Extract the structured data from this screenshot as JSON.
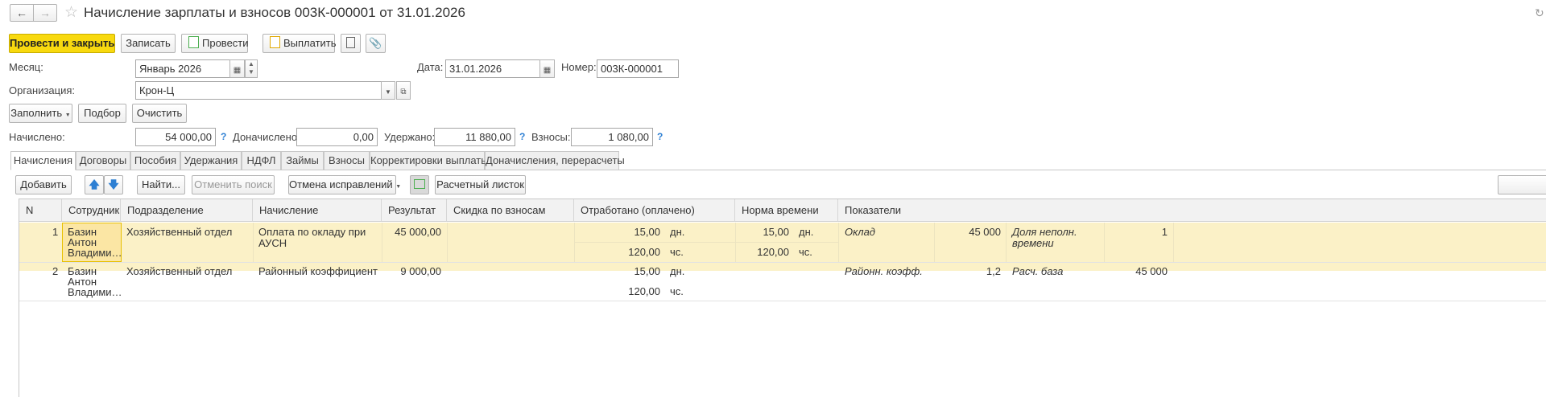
{
  "header": {
    "title": "Начисление зарплаты и взносов 003К-000001 от 31.01.2026"
  },
  "toolbar": {
    "post_close": "Провести и закрыть",
    "save": "Записать",
    "post": "Провести",
    "pay": "Выплатить"
  },
  "form": {
    "month_label": "Месяц:",
    "month_value": "Январь 2026",
    "date_label": "Дата:",
    "date_value": "31.01.2026",
    "number_label": "Номер:",
    "number_value": "003К-000001",
    "org_label": "Организация:",
    "org_value": "Крон-Ц"
  },
  "actions": {
    "fill": "Заполнить",
    "select": "Подбор",
    "clear": "Очистить"
  },
  "totals": {
    "accrued_label": "Начислено:",
    "accrued_value": "54 000,00",
    "additional_label": "Доначислено:",
    "additional_value": "0,00",
    "withheld_label": "Удержано:",
    "withheld_value": "11 880,00",
    "contrib_label": "Взносы:",
    "contrib_value": "1 080,00",
    "help_mark": "?"
  },
  "tabs": [
    "Начисления",
    "Договоры",
    "Пособия",
    "Удержания",
    "НДФЛ",
    "Займы",
    "Взносы",
    "Корректировки выплаты",
    "Доначисления, перерасчеты"
  ],
  "table_toolbar": {
    "add": "Добавить",
    "find": "Найти...",
    "cancel_search": "Отменить поиск",
    "cancel_fix": "Отмена исправлений",
    "payslip": "Расчетный листок"
  },
  "table": {
    "columns": [
      "N",
      "Сотрудник",
      "Подразделение",
      "Начисление",
      "Результат",
      "Скидка по взносам",
      "Отработано (оплачено)",
      "Норма времени",
      "Показатели"
    ],
    "rows": [
      {
        "n": "1",
        "employee": [
          "Базин",
          "Антон",
          "Владими…"
        ],
        "department": "Хозяйственный отдел",
        "accrual": [
          "Оплата по окладу при",
          "АУСН"
        ],
        "result": "45 000,00",
        "worked_days": "15,00",
        "worked_days_unit": "дн.",
        "worked_hours": "120,00",
        "worked_hours_unit": "чс.",
        "norm_days": "15,00",
        "norm_days_unit": "дн.",
        "norm_hours": "120,00",
        "norm_hours_unit": "чс.",
        "ind1_name": "Оклад",
        "ind1_value": "45 000",
        "ind2_name": [
          "Доля неполн.",
          "времени"
        ],
        "ind2_value": "1"
      },
      {
        "n": "2",
        "employee": [
          "Базин",
          "Антон",
          "Владими…"
        ],
        "department": "Хозяйственный отдел",
        "accrual": [
          "Районный коэффициент"
        ],
        "result": "9 000,00",
        "worked_days": "15,00",
        "worked_days_unit": "дн.",
        "worked_hours": "120,00",
        "worked_hours_unit": "чс.",
        "ind1_name": "Районн. коэфф.",
        "ind1_value": "1,2",
        "ind2_name": [
          "Расч. база"
        ],
        "ind2_value": "45 000"
      }
    ]
  }
}
